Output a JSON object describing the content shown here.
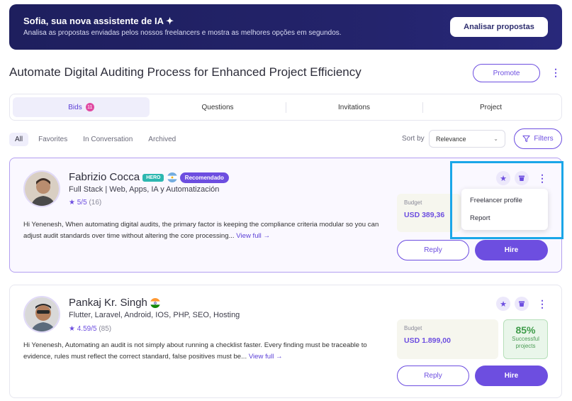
{
  "banner": {
    "title": "Sofia, sua nova assistente de IA ✦",
    "subtitle": "Analisa as propostas enviadas pelos nossos freelancers e mostra as melhores opções em segundos.",
    "button": "Analisar propostas"
  },
  "project": {
    "title": "Automate Digital Auditing Process for Enhanced Project Efficiency",
    "promote": "Promote"
  },
  "tabs": [
    {
      "label": "Bids",
      "badge": "11"
    },
    {
      "label": "Questions"
    },
    {
      "label": "Invitations"
    },
    {
      "label": "Project"
    }
  ],
  "filters": {
    "chips": [
      "All",
      "Favorites",
      "In Conversation",
      "Archived"
    ],
    "sort_label": "Sort by",
    "sort_value": "Relevance",
    "filters_button": "Filters"
  },
  "bids": [
    {
      "name": "Fabrizio Cocca",
      "hero": "HERO",
      "recommended": "Recomendado",
      "role": "Full Stack | Web, Apps, IA y Automatización",
      "rating": "5/5",
      "reviews": "(16)",
      "description": "Hi Yenenesh, When automating digital audits, the primary factor is keeping the compliance criteria modular so you can adjust audit standards over time without altering the core processing...",
      "view_full": "View full →",
      "budget_label": "Budget",
      "budget_value": "USD 389,36",
      "reply": "Reply",
      "hire": "Hire"
    },
    {
      "name": "Pankaj Kr. Singh",
      "role": "Flutter, Laravel, Android, IOS, PHP, SEO, Hosting",
      "rating": "4.59/5",
      "reviews": "(85)",
      "description": "Hi Yenenesh, Automating an audit is not simply about running a checklist faster. Every finding must be traceable to evidence, rules must reflect the correct standard, false positives must be...",
      "view_full": "View full →",
      "budget_label": "Budget",
      "budget_value": "USD 1.899,00",
      "success_pct": "85%",
      "success_label": "Successful projects",
      "reply": "Reply",
      "hire": "Hire"
    }
  ],
  "menu": {
    "items": [
      "Freelancer profile",
      "Report"
    ]
  },
  "colors": {
    "accent": "#6d4ee0",
    "banner_bg": "#1e1f5e",
    "focus": "#1aa6e8"
  }
}
